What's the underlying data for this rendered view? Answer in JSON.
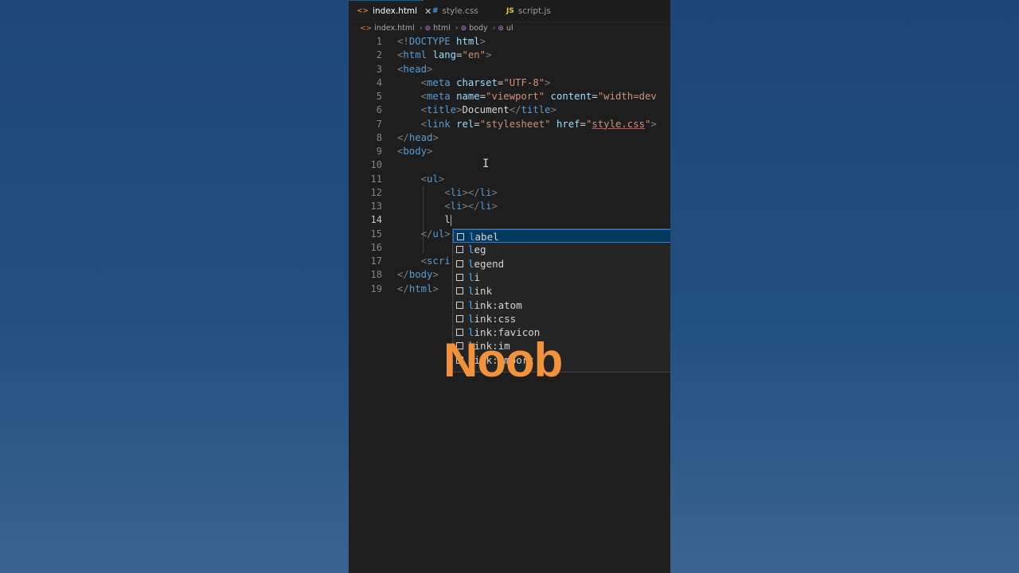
{
  "tabs": [
    {
      "label": "index.html",
      "icon": "<>",
      "active": true,
      "close": "✕"
    },
    {
      "label": "style.css",
      "icon": "#",
      "active": false
    },
    {
      "label": "script.js",
      "icon": "JS",
      "active": false
    }
  ],
  "breadcrumb": {
    "file": "index.html",
    "file_icon": "<>",
    "path": [
      "html",
      "body",
      "ul"
    ],
    "path_icon": "⊚"
  },
  "colors": {
    "accent": "#0e639c",
    "tag": "#569cd6",
    "attr": "#9cdcfe",
    "string": "#ce9178",
    "overlay": "#f2923a"
  },
  "code": {
    "current_line": 14,
    "lines": [
      {
        "n": "1",
        "t": [
          [
            "br",
            "<!"
          ],
          [
            "tg",
            "DOCTYPE"
          ],
          [
            "tx",
            " "
          ],
          [
            "at",
            "html"
          ],
          [
            "br",
            ">"
          ]
        ]
      },
      {
        "n": "2",
        "t": [
          [
            "br",
            "<"
          ],
          [
            "tg",
            "html"
          ],
          [
            "tx",
            " "
          ],
          [
            "at",
            "lang"
          ],
          [
            "tx",
            "="
          ],
          [
            "st",
            "\"en\""
          ],
          [
            "br",
            ">"
          ]
        ]
      },
      {
        "n": "3",
        "t": [
          [
            "br",
            "<"
          ],
          [
            "tg",
            "head"
          ],
          [
            "br",
            ">"
          ]
        ]
      },
      {
        "n": "4",
        "t": [
          [
            "tx",
            "    "
          ],
          [
            "br",
            "<"
          ],
          [
            "tg",
            "meta"
          ],
          [
            "tx",
            " "
          ],
          [
            "at",
            "charset"
          ],
          [
            "tx",
            "="
          ],
          [
            "st",
            "\"UTF-8\""
          ],
          [
            "br",
            ">"
          ]
        ]
      },
      {
        "n": "5",
        "t": [
          [
            "tx",
            "    "
          ],
          [
            "br",
            "<"
          ],
          [
            "tg",
            "meta"
          ],
          [
            "tx",
            " "
          ],
          [
            "at",
            "name"
          ],
          [
            "tx",
            "="
          ],
          [
            "st",
            "\"viewport\""
          ],
          [
            "tx",
            " "
          ],
          [
            "at",
            "content"
          ],
          [
            "tx",
            "="
          ],
          [
            "st",
            "\"width=dev"
          ]
        ]
      },
      {
        "n": "6",
        "t": [
          [
            "tx",
            "    "
          ],
          [
            "br",
            "<"
          ],
          [
            "tg",
            "title"
          ],
          [
            "br",
            ">"
          ],
          [
            "tx",
            "Document"
          ],
          [
            "br",
            "</"
          ],
          [
            "tg",
            "title"
          ],
          [
            "br",
            ">"
          ]
        ]
      },
      {
        "n": "7",
        "t": [
          [
            "tx",
            "    "
          ],
          [
            "br",
            "<"
          ],
          [
            "tg",
            "link"
          ],
          [
            "tx",
            " "
          ],
          [
            "at",
            "rel"
          ],
          [
            "tx",
            "="
          ],
          [
            "st",
            "\"stylesheet\""
          ],
          [
            "tx",
            " "
          ],
          [
            "at",
            "href"
          ],
          [
            "tx",
            "="
          ],
          [
            "st",
            "\""
          ],
          [
            "stu",
            "style.css"
          ],
          [
            "st",
            "\""
          ],
          [
            "br",
            ">"
          ]
        ]
      },
      {
        "n": "8",
        "t": [
          [
            "br",
            "</"
          ],
          [
            "tg",
            "head"
          ],
          [
            "br",
            ">"
          ]
        ]
      },
      {
        "n": "9",
        "t": [
          [
            "br",
            "<"
          ],
          [
            "tg",
            "body"
          ],
          [
            "br",
            ">"
          ]
        ]
      },
      {
        "n": "10",
        "t": []
      },
      {
        "n": "11",
        "t": [
          [
            "tx",
            "    "
          ],
          [
            "br",
            "<"
          ],
          [
            "tg",
            "ul"
          ],
          [
            "br",
            ">"
          ]
        ]
      },
      {
        "n": "12",
        "t": [
          [
            "tx",
            "        "
          ],
          [
            "br",
            "<"
          ],
          [
            "tg",
            "li"
          ],
          [
            "br",
            "></"
          ],
          [
            "tg",
            "li"
          ],
          [
            "br",
            ">"
          ]
        ]
      },
      {
        "n": "13",
        "t": [
          [
            "tx",
            "        "
          ],
          [
            "br",
            "<"
          ],
          [
            "tg",
            "li"
          ],
          [
            "br",
            "></"
          ],
          [
            "tg",
            "li"
          ],
          [
            "br",
            ">"
          ]
        ]
      },
      {
        "n": "14",
        "t": [
          [
            "tx",
            "        l"
          ]
        ]
      },
      {
        "n": "15",
        "t": [
          [
            "tx",
            "    "
          ],
          [
            "br",
            "</"
          ],
          [
            "tg",
            "ul"
          ],
          [
            "br",
            ">"
          ]
        ]
      },
      {
        "n": "16",
        "t": []
      },
      {
        "n": "17",
        "t": [
          [
            "tx",
            "    "
          ],
          [
            "br",
            "<"
          ],
          [
            "tg",
            "scri"
          ]
        ]
      },
      {
        "n": "18",
        "t": [
          [
            "br",
            "</"
          ],
          [
            "tg",
            "body"
          ],
          [
            "br",
            ">"
          ]
        ]
      },
      {
        "n": "19",
        "t": [
          [
            "br",
            "</"
          ],
          [
            "tg",
            "html"
          ],
          [
            "br",
            ">"
          ]
        ]
      }
    ]
  },
  "suggestions": [
    {
      "match": "l",
      "rest": "abel",
      "selected": true
    },
    {
      "match": "l",
      "rest": "eg"
    },
    {
      "match": "l",
      "rest": "egend"
    },
    {
      "match": "l",
      "rest": "i"
    },
    {
      "match": "l",
      "rest": "ink"
    },
    {
      "match": "l",
      "rest": "ink:atom"
    },
    {
      "match": "l",
      "rest": "ink:css"
    },
    {
      "match": "l",
      "rest": "ink:favicon"
    },
    {
      "match": "l",
      "rest": "ink:im"
    },
    {
      "match": "l",
      "rest": "ink:import"
    }
  ],
  "overlay_text": "Noob",
  "icons": {
    "cursor": "text-cursor-icon",
    "suggestion": "snippet-box-icon"
  }
}
